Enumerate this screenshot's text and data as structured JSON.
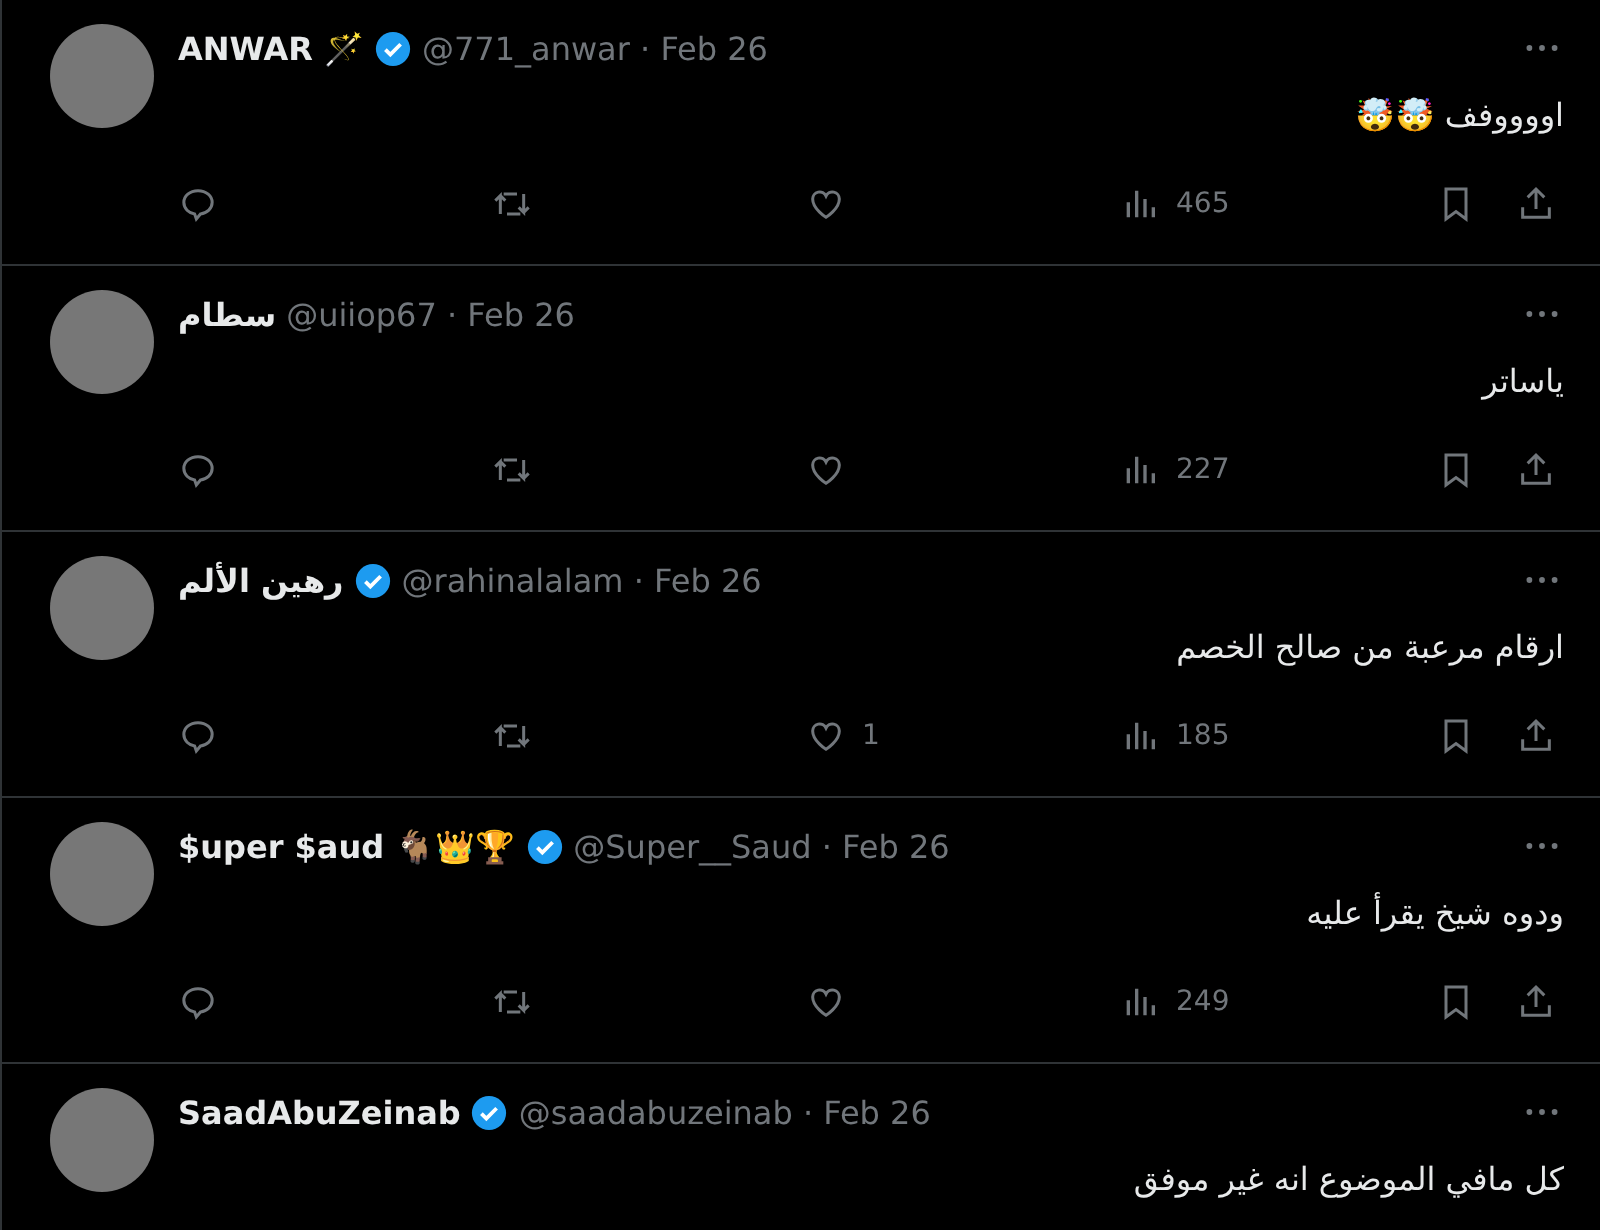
{
  "tweets": [
    {
      "name": "ANWAR 🪄",
      "verified": true,
      "handle_date": "@771_anwar · Feb 26",
      "text": "اووووفف 🤯🤯",
      "views": "465"
    },
    {
      "name": "سطام",
      "verified": false,
      "handle_date": "@uiiop67 · Feb 26",
      "text": "ياساتر",
      "views": "227"
    },
    {
      "name": "رهين الألم",
      "verified": true,
      "handle_date": "@rahinalalam · Feb 26",
      "text": "ارقام مرعبة من صالح الخصم",
      "likes": "1",
      "views": "185"
    },
    {
      "name": "$uper $aud 🐐👑🏆",
      "verified": true,
      "handle_date": "@Super__Saud · Feb 26",
      "text": "ودوه شيخ يقرأ عليه",
      "views": "249"
    },
    {
      "name": "SaadAbuZeinab",
      "verified": true,
      "handle_date": "@saadabuzeinab · Feb 26",
      "text": "كل مافي الموضوع انه غير موفق"
    }
  ]
}
